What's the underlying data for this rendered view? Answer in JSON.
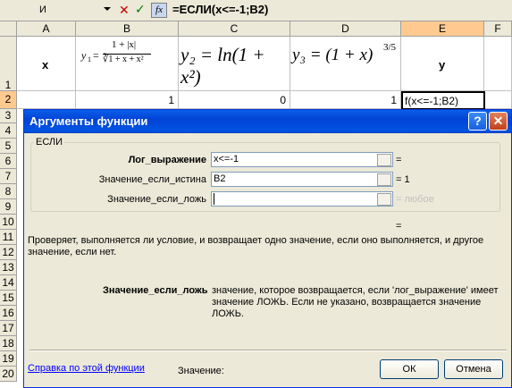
{
  "formula_bar": {
    "name_box": "И",
    "cancel_icon": "✕",
    "enter_icon": "✓",
    "fx_label": "fx",
    "formula": "=ЕСЛИ(x<=-1;B2)"
  },
  "columns": [
    "A",
    "B",
    "C",
    "D",
    "E",
    "F"
  ],
  "rows": [
    "1",
    "2",
    "3",
    "4",
    "5",
    "6",
    "7",
    "8",
    "9",
    "10",
    "11",
    "12",
    "13",
    "14",
    "15",
    "16",
    "17",
    "18",
    "19",
    "20"
  ],
  "cells": {
    "a1": "x",
    "e1": "y",
    "b2": "1",
    "c2": "0",
    "d2": "1",
    "e2": "f(x<=-1;B2)"
  },
  "formulas": {
    "y1_lhs": "y",
    "y1_sub": "1",
    "y1_eq": "=",
    "y1_num": "1 + |x|",
    "y1_den": "∛1 + x + x²",
    "y2_text": "y₂ = ln(1 + x²)",
    "y3_text": "y₃ = (1 + x)",
    "y3_exp": "3/5"
  },
  "dialog": {
    "title": "Аргументы функции",
    "help_icon": "?",
    "close_icon": "✕",
    "group_label": "ЕСЛИ",
    "args": [
      {
        "label": "Лог_выражение",
        "value": "x<=-1",
        "result": "=",
        "bold": true
      },
      {
        "label": "Значение_если_истина",
        "value": "B2",
        "result": "= 1",
        "bold": false
      },
      {
        "label": "Значение_если_ложь",
        "value": "",
        "result": "= любое",
        "bold": false
      }
    ],
    "overall_result": "=",
    "description": "Проверяет, выполняется ли условие, и возвращает одно значение, если оно выполняется, и другое значение, если нет.",
    "arg_help_name": "Значение_если_ложь",
    "arg_help_text": "значение, которое возвращается, если 'лог_выражение' имеет значение ЛОЖЬ. Если не указано, возвращается значение ЛОЖЬ.",
    "help_link": "Справка по этой функции",
    "value_label": "Значение:",
    "ok_label": "ОК",
    "cancel_label": "Отмена"
  }
}
